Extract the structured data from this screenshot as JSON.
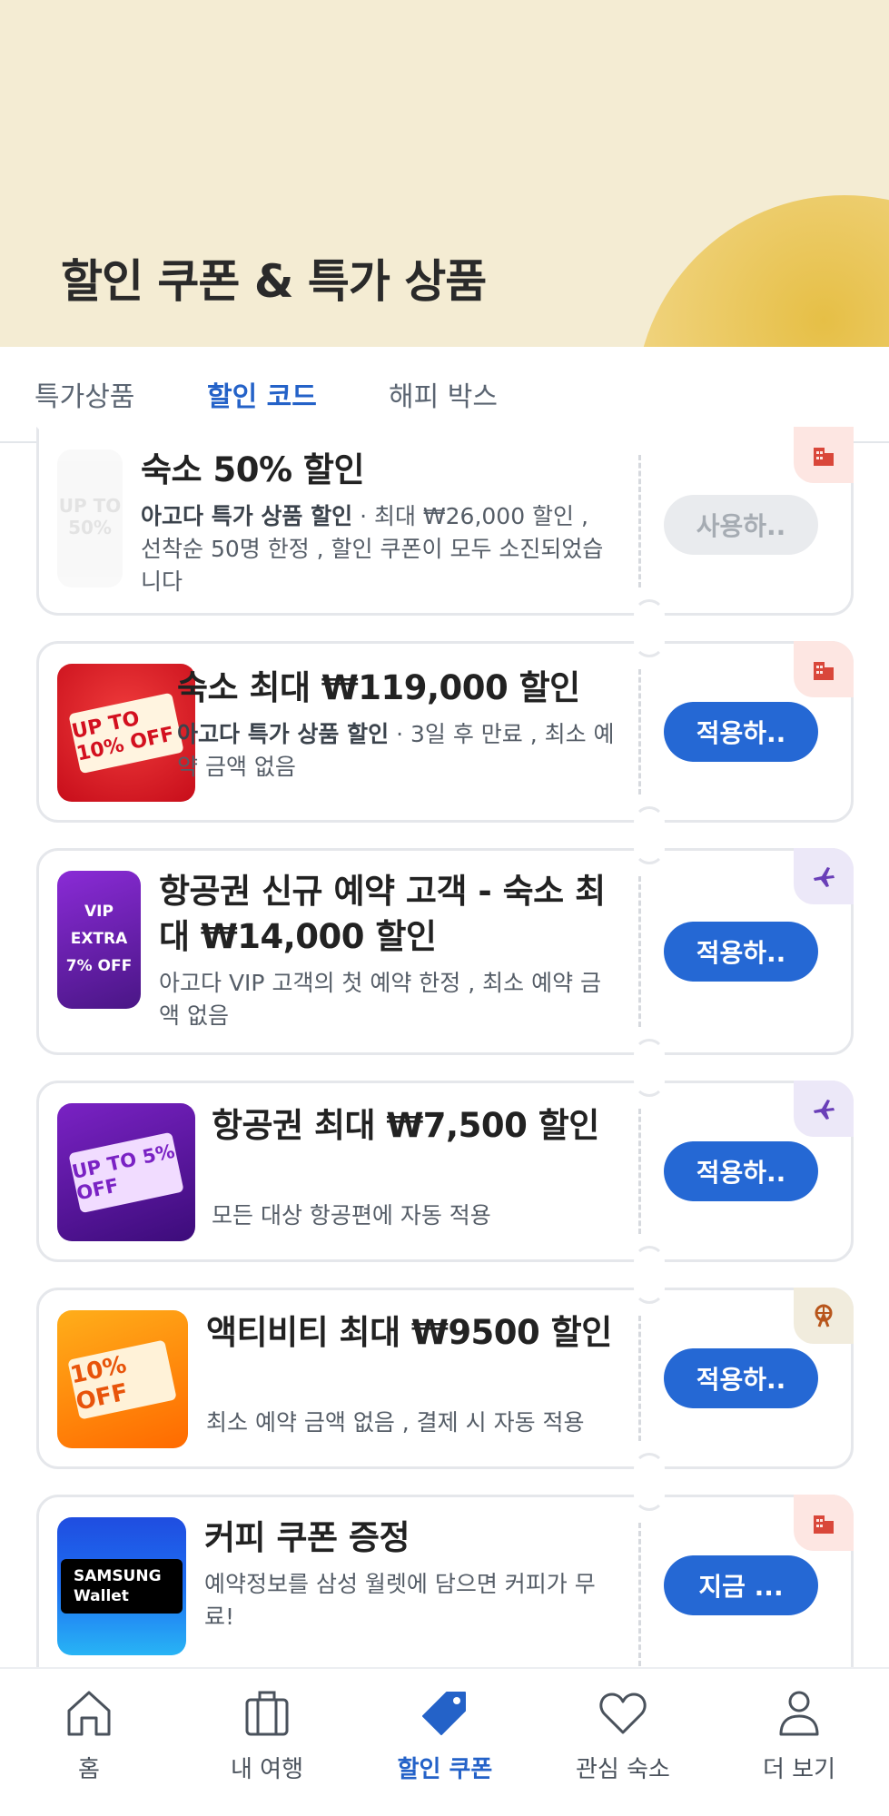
{
  "header": {
    "title": "할인 쿠폰 & 특가 상품"
  },
  "tabs": [
    {
      "label": "특가상품"
    },
    {
      "label": "할인 코드"
    },
    {
      "label": "해피 박스"
    }
  ],
  "coupons": [
    {
      "title": "숙소 50% 할인",
      "desc_bold": "아고다 특가 상품 할인",
      "desc": " · 최대 ₩26,000 할인 , 선착순 50명 한정 , 할인 쿠폰이 모두 소진되었습니다",
      "button": "사용하..",
      "thumb_text": "UP TO 50%",
      "category": "hotel"
    },
    {
      "title": "숙소 최대 ₩119,000 할인",
      "desc_bold": "아고다 특가 상품 할인",
      "desc": " · 3일 후 만료 , 최소 예약 금액 없음",
      "button": "적용하..",
      "thumb_text": "UP TO 10% OFF",
      "category": "hotel"
    },
    {
      "title": "항공권 신규 예약 고객 - 숙소 최대 ₩14,000 할인",
      "desc_bold": "",
      "desc": "아고다 VIP 고객의 첫 예약 한정 , 최소 예약 금액 없음",
      "button": "적용하..",
      "thumb_text": "VIP EXTRA 7% OFF",
      "category": "flight"
    },
    {
      "title": "항공권 최대 ₩7,500 할인",
      "desc_bold": "",
      "desc": "모든 대상 항공편에 자동 적용",
      "button": "적용하..",
      "thumb_text": "UP TO 5% OFF",
      "category": "flight"
    },
    {
      "title": "액티비티 최대 ₩9500 할인",
      "desc_bold": "",
      "desc": "최소 예약 금액 없음 , 결제 시 자동 적용",
      "button": "적용하..",
      "thumb_text": "10% OFF",
      "category": "activity"
    },
    {
      "title": "커피 쿠폰 증정",
      "desc_bold": "",
      "desc": "예약정보를 삼성 월렛에 담으면 커피가 무료!",
      "button": "지금 ...",
      "thumb_text": "SAMSUNG Wallet",
      "category": "hotel"
    }
  ],
  "bottom_nav": [
    {
      "label": "홈",
      "icon": "home-icon"
    },
    {
      "label": "내 여행",
      "icon": "suitcase-icon"
    },
    {
      "label": "할인 쿠폰",
      "icon": "tag-icon"
    },
    {
      "label": "관심 숙소",
      "icon": "heart-icon"
    },
    {
      "label": "더 보기",
      "icon": "person-icon"
    }
  ],
  "colors": {
    "accent": "#2462c8",
    "header_bg": "#f4ecd3",
    "button": "#2568d4"
  }
}
